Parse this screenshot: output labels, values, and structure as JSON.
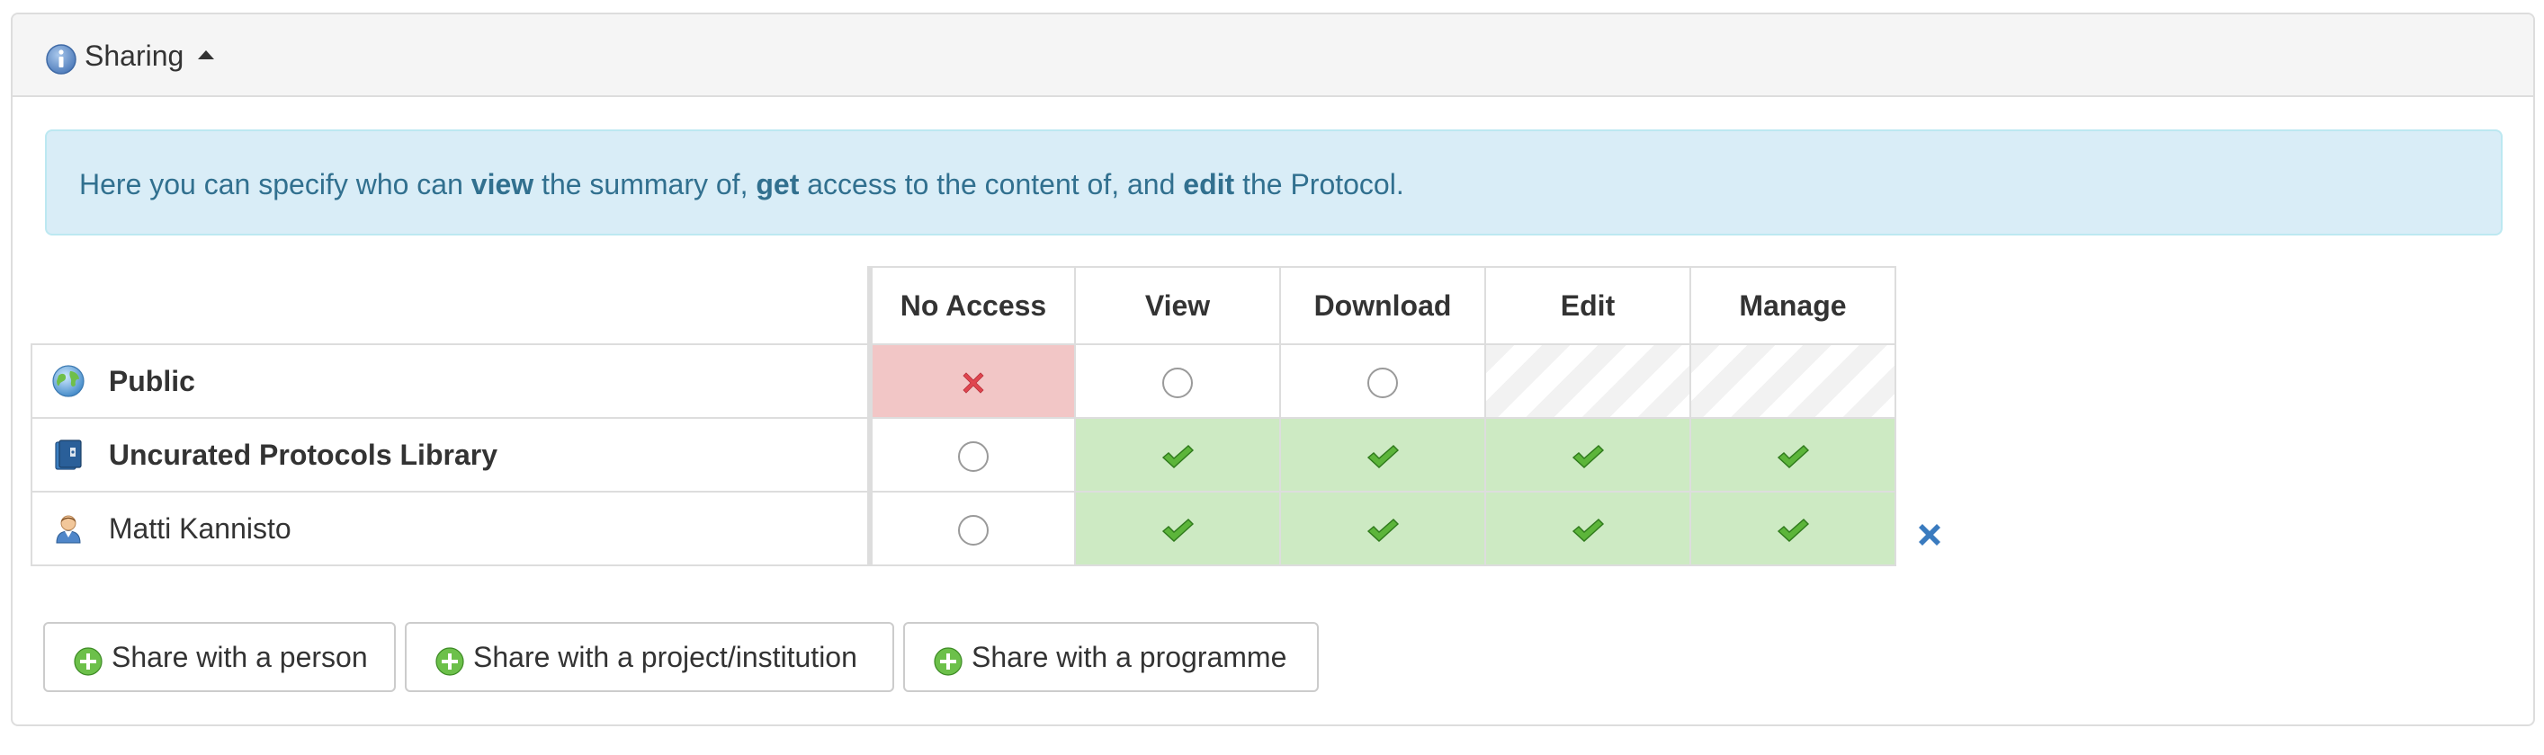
{
  "panel": {
    "title": "Sharing"
  },
  "alert": {
    "part1": "Here you can specify who can ",
    "view": "view",
    "part2": " the summary of, ",
    "get": "get",
    "part3": " access to the content of, and ",
    "edit": "edit",
    "part4": " the Protocol."
  },
  "table": {
    "columns": [
      "No Access",
      "View",
      "Download",
      "Edit",
      "Manage"
    ],
    "rows": [
      {
        "name": "Public",
        "icon": "globe-icon",
        "access": "No Access"
      },
      {
        "name": "Uncurated Protocols Library",
        "icon": "library-icon",
        "access": "Manage"
      },
      {
        "name": "Matti Kannisto",
        "icon": "person-icon",
        "access": "Manage"
      }
    ]
  },
  "buttons": {
    "share_person": "Share with a person",
    "share_project": "Share with a project/institution",
    "share_programme": "Share with a programme"
  },
  "colors": {
    "no_access_bg": "#f2c6c6",
    "granted_bg": "#cdeac3",
    "alert_bg": "#d9edf7",
    "alert_text": "#31708f",
    "remove_x": "#3a7bbf"
  }
}
